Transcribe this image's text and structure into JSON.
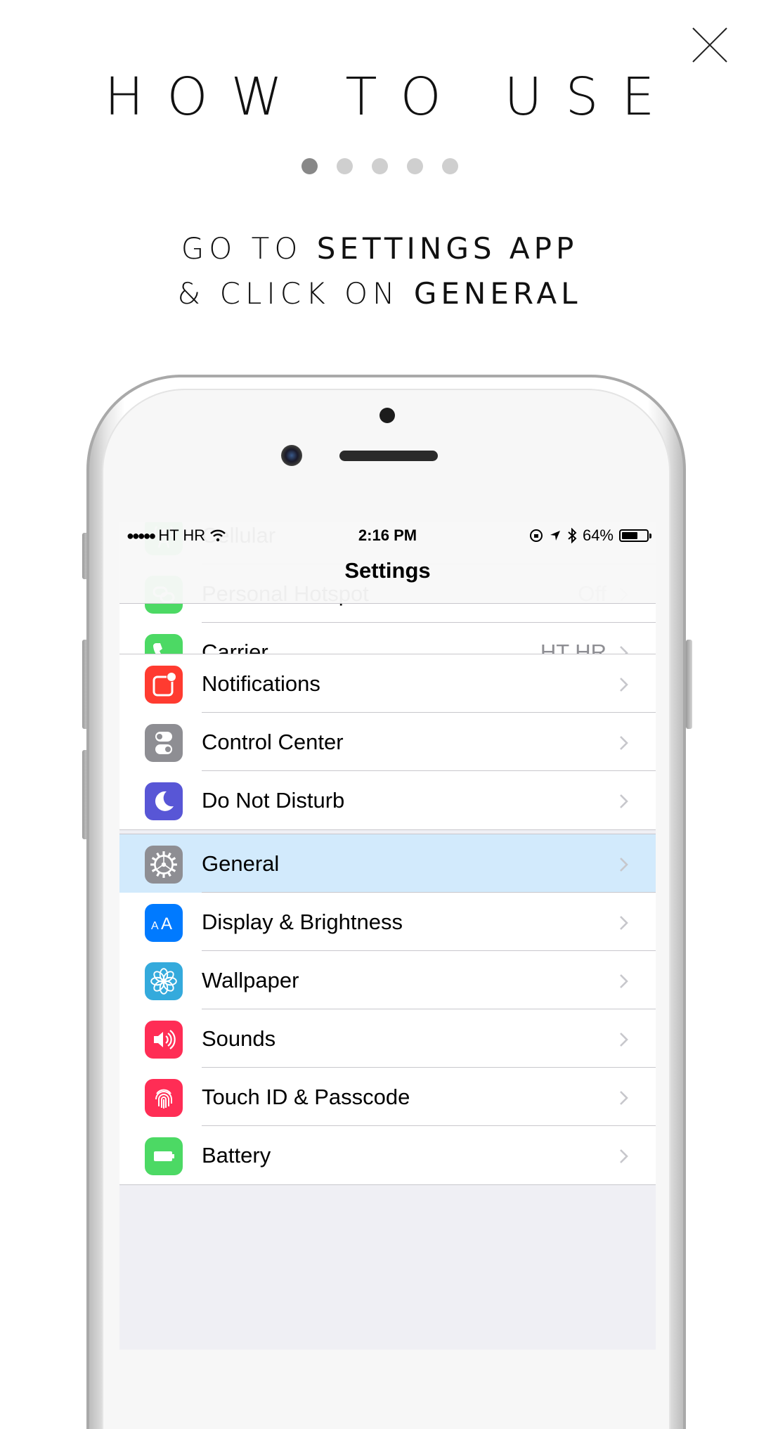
{
  "tutorial": {
    "title": "HOW TO USE",
    "pager": {
      "total": 5,
      "active": 1
    },
    "instruction": {
      "line1_light": "GO TO",
      "line1_strong": "SETTINGS APP",
      "line2_light": "& CLICK ON",
      "line2_strong": "GENERAL"
    }
  },
  "status_bar": {
    "signal": "●●●●●",
    "carrier": "HT HR",
    "time": "2:16 PM",
    "battery": "64%",
    "battery_level": 0.64
  },
  "nav": {
    "title": "Settings"
  },
  "groups": [
    {
      "rows": [
        {
          "label": "Cellular",
          "value": "",
          "icon": "cellular-icon",
          "color": "#4cd964"
        },
        {
          "label": "Personal Hotspot",
          "value": "Off",
          "icon": "hotspot-icon",
          "color": "#4cd964"
        },
        {
          "label": "Carrier",
          "value": "HT HR",
          "icon": "phone-icon",
          "color": "#4cd964"
        }
      ]
    },
    {
      "rows": [
        {
          "label": "Notifications",
          "value": "",
          "icon": "notifications-icon",
          "color": "#ff3b30"
        },
        {
          "label": "Control Center",
          "value": "",
          "icon": "control-center-icon",
          "color": "#8e8e93"
        },
        {
          "label": "Do Not Disturb",
          "value": "",
          "icon": "moon-icon",
          "color": "#5856d6"
        }
      ]
    },
    {
      "rows": [
        {
          "label": "General",
          "value": "",
          "icon": "gear-icon",
          "color": "#8e8e93",
          "highlight": true
        },
        {
          "label": "Display & Brightness",
          "value": "",
          "icon": "display-icon",
          "color": "#007aff",
          "glyph": "AA"
        },
        {
          "label": "Wallpaper",
          "value": "",
          "icon": "wallpaper-flower-icon",
          "color": "#34aadc"
        },
        {
          "label": "Sounds",
          "value": "",
          "icon": "speaker-icon",
          "color": "#ff2d55"
        },
        {
          "label": "Touch ID & Passcode",
          "value": "",
          "icon": "fingerprint-icon",
          "color": "#ff2d55"
        },
        {
          "label": "Battery",
          "value": "",
          "icon": "battery-icon",
          "color": "#4cd964"
        }
      ]
    }
  ]
}
